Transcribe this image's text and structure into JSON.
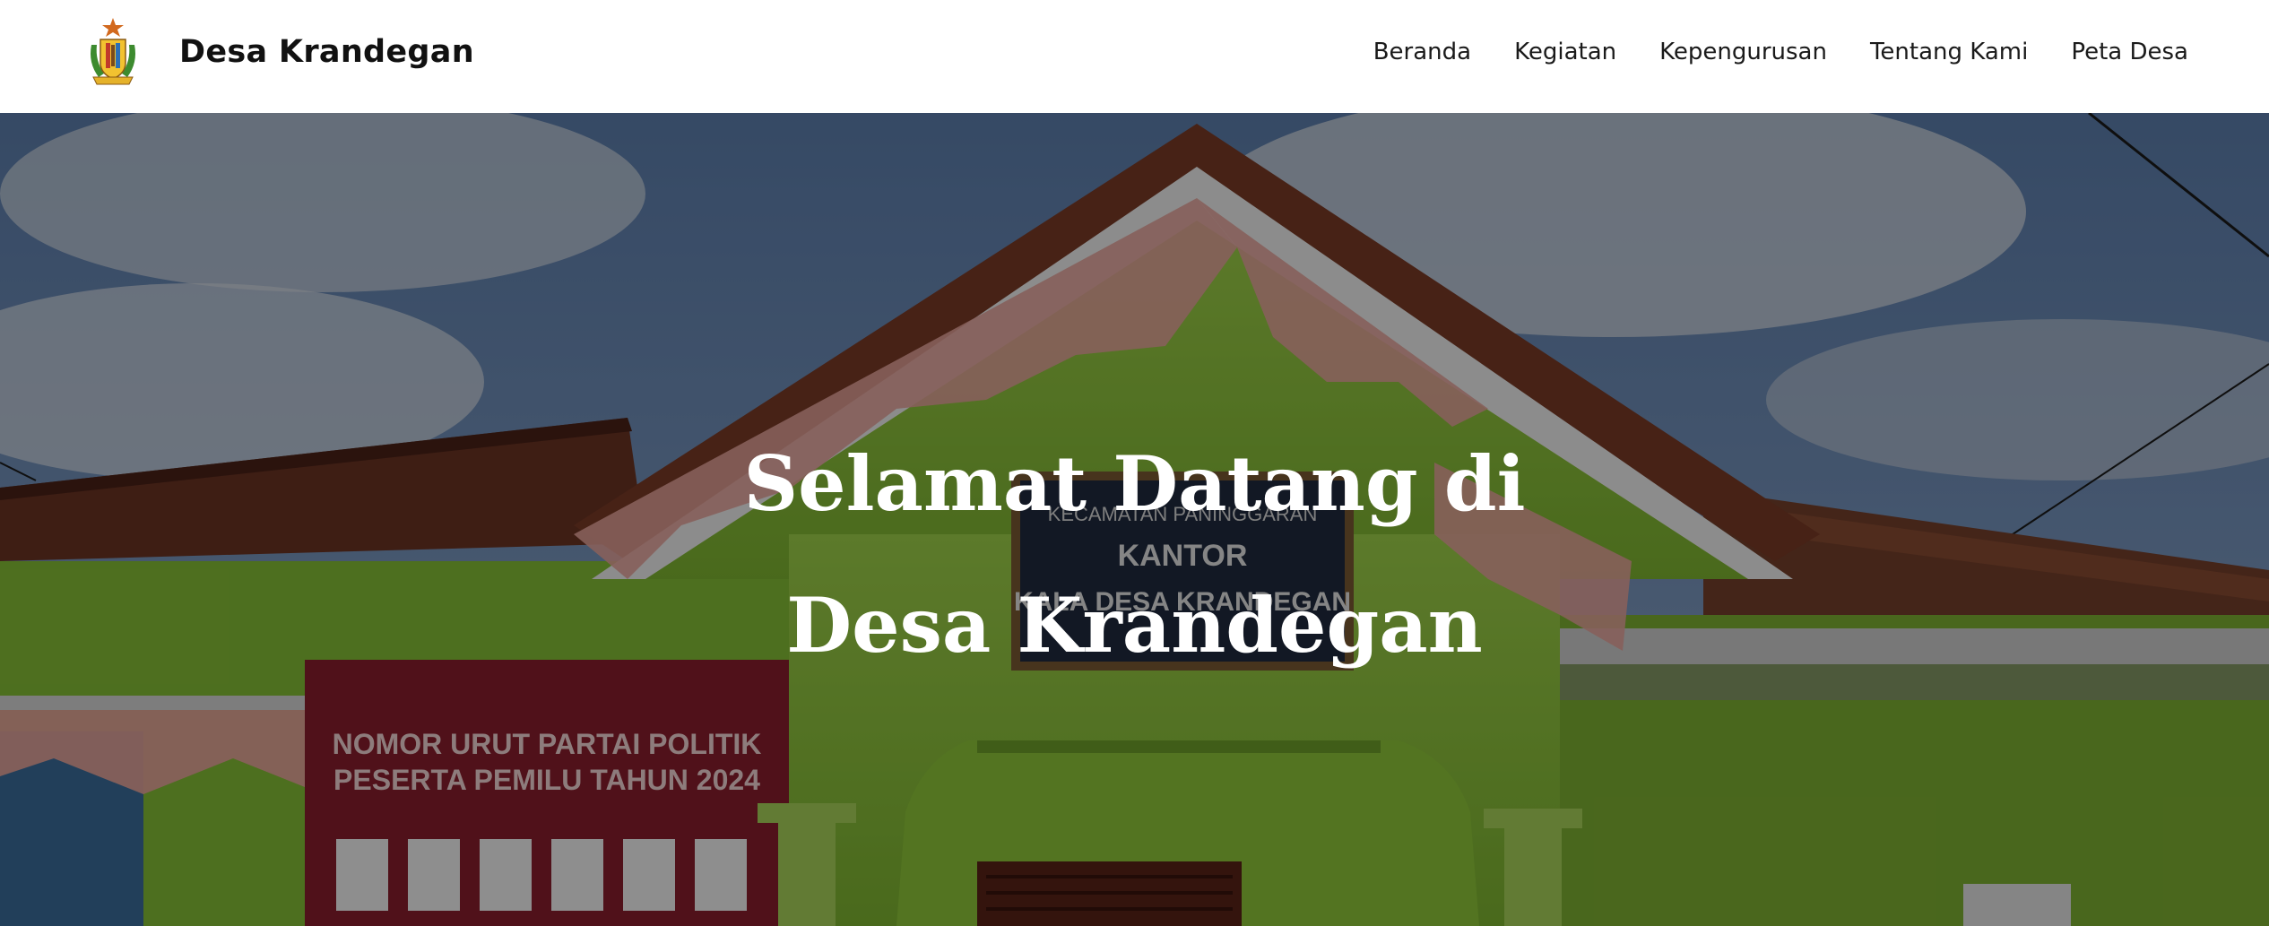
{
  "brand": {
    "name": "Desa Krandegan",
    "logo_icon": "village-emblem-icon"
  },
  "nav": {
    "items": [
      {
        "label": "Beranda"
      },
      {
        "label": "Kegiatan"
      },
      {
        "label": "Kepengurusan"
      },
      {
        "label": "Tentang Kami"
      },
      {
        "label": "Peta Desa"
      }
    ]
  },
  "hero": {
    "title_line1": "Selamat Datang di",
    "title_line2": "Desa Krandegan",
    "sign": {
      "line1": "KECAMATAN PANINGGARAN",
      "line2": "KANTOR",
      "line3": "KALA DESA KRANDEGAN"
    },
    "banner": {
      "line1": "NOMOR URUT PARTAI POLITIK",
      "line2": "PESERTA PEMILU TAHUN 2024"
    }
  },
  "colors": {
    "navbar_bg": "#ffffff",
    "nav_text": "#1a1a1a",
    "hero_text": "#ffffff",
    "wall_green": "#8cc63f",
    "roof_brown": "#7a3b27",
    "bunting_pink": "#e9a7a0",
    "sky_blue": "#6f8fb8"
  }
}
